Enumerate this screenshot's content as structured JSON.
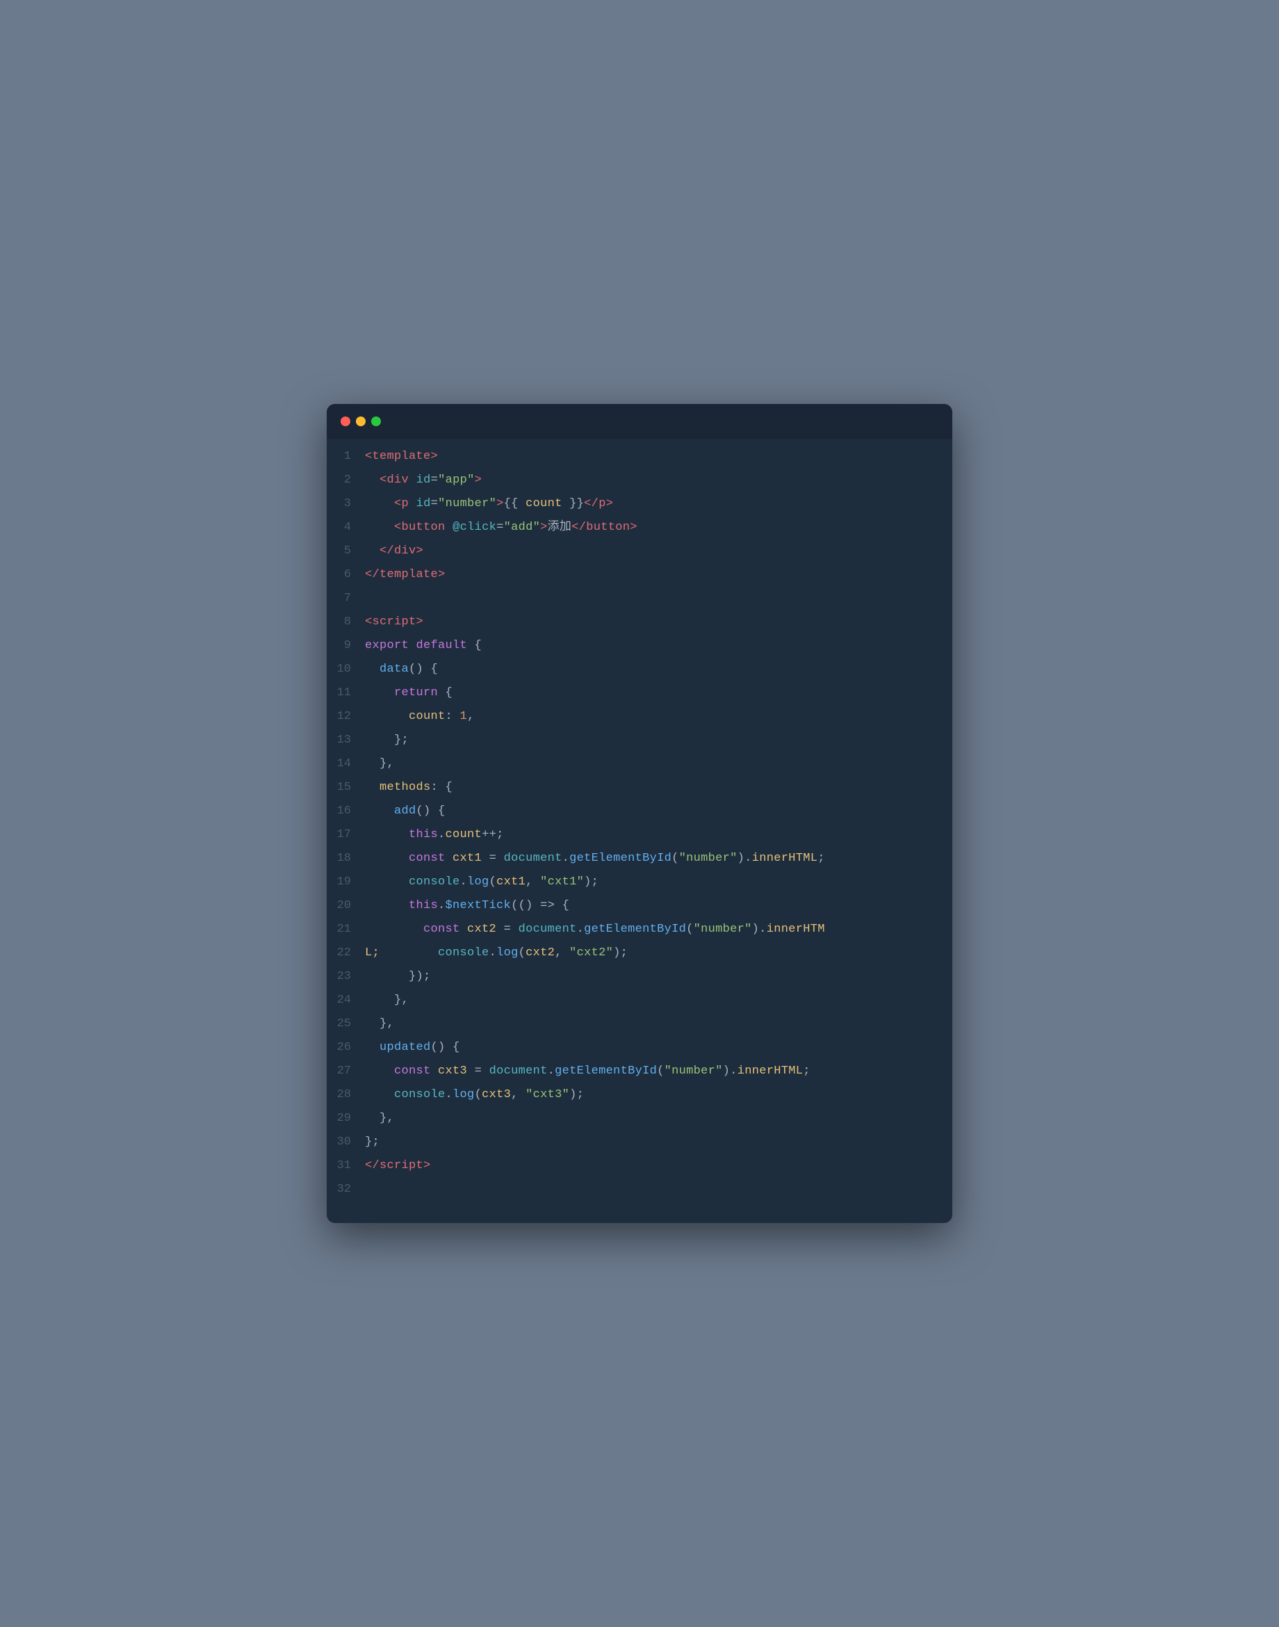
{
  "window": {
    "titlebar": {
      "dot_red": "close",
      "dot_yellow": "minimize",
      "dot_green": "maximize"
    }
  },
  "lines": [
    {
      "num": "1",
      "tokens": [
        {
          "t": "<",
          "c": "c-tag"
        },
        {
          "t": "template",
          "c": "c-tag"
        },
        {
          "t": ">",
          "c": "c-tag"
        }
      ]
    },
    {
      "num": "2",
      "tokens": [
        {
          "t": "  ",
          "c": "c-white"
        },
        {
          "t": "<",
          "c": "c-tag"
        },
        {
          "t": "div",
          "c": "c-tag"
        },
        {
          "t": " ",
          "c": "c-white"
        },
        {
          "t": "id",
          "c": "c-attr"
        },
        {
          "t": "=",
          "c": "c-white"
        },
        {
          "t": "\"app\"",
          "c": "c-string"
        },
        {
          "t": ">",
          "c": "c-tag"
        }
      ]
    },
    {
      "num": "3",
      "tokens": [
        {
          "t": "    ",
          "c": "c-white"
        },
        {
          "t": "<",
          "c": "c-tag"
        },
        {
          "t": "p",
          "c": "c-tag"
        },
        {
          "t": " ",
          "c": "c-white"
        },
        {
          "t": "id",
          "c": "c-attr"
        },
        {
          "t": "=",
          "c": "c-white"
        },
        {
          "t": "\"number\"",
          "c": "c-string"
        },
        {
          "t": ">",
          "c": "c-tag"
        },
        {
          "t": "{{ ",
          "c": "c-interp"
        },
        {
          "t": "count",
          "c": "c-count"
        },
        {
          "t": " }}",
          "c": "c-interp"
        },
        {
          "t": "</",
          "c": "c-tag"
        },
        {
          "t": "p",
          "c": "c-tag"
        },
        {
          "t": ">",
          "c": "c-tag"
        }
      ]
    },
    {
      "num": "4",
      "tokens": [
        {
          "t": "    ",
          "c": "c-white"
        },
        {
          "t": "<",
          "c": "c-tag"
        },
        {
          "t": "button",
          "c": "c-tag"
        },
        {
          "t": " ",
          "c": "c-white"
        },
        {
          "t": "@click",
          "c": "c-attr"
        },
        {
          "t": "=",
          "c": "c-white"
        },
        {
          "t": "\"add\"",
          "c": "c-string"
        },
        {
          "t": ">",
          "c": "c-tag"
        },
        {
          "t": "添加",
          "c": "c-white"
        },
        {
          "t": "</",
          "c": "c-tag"
        },
        {
          "t": "button",
          "c": "c-tag"
        },
        {
          "t": ">",
          "c": "c-tag"
        }
      ]
    },
    {
      "num": "5",
      "tokens": [
        {
          "t": "  ",
          "c": "c-white"
        },
        {
          "t": "</",
          "c": "c-tag"
        },
        {
          "t": "div",
          "c": "c-tag"
        },
        {
          "t": ">",
          "c": "c-tag"
        }
      ]
    },
    {
      "num": "6",
      "tokens": [
        {
          "t": "</",
          "c": "c-tag"
        },
        {
          "t": "template",
          "c": "c-tag"
        },
        {
          "t": ">",
          "c": "c-tag"
        }
      ]
    },
    {
      "num": "7",
      "tokens": []
    },
    {
      "num": "8",
      "tokens": [
        {
          "t": "<",
          "c": "c-tag"
        },
        {
          "t": "script",
          "c": "c-tag"
        },
        {
          "t": ">",
          "c": "c-tag"
        }
      ]
    },
    {
      "num": "9",
      "tokens": [
        {
          "t": "export",
          "c": "c-keyword"
        },
        {
          "t": " ",
          "c": "c-white"
        },
        {
          "t": "default",
          "c": "c-keyword"
        },
        {
          "t": " {",
          "c": "c-white"
        }
      ]
    },
    {
      "num": "10",
      "tokens": [
        {
          "t": "  ",
          "c": "c-white"
        },
        {
          "t": "data",
          "c": "c-func"
        },
        {
          "t": "() {",
          "c": "c-white"
        }
      ]
    },
    {
      "num": "11",
      "tokens": [
        {
          "t": "    ",
          "c": "c-white"
        },
        {
          "t": "return",
          "c": "c-keyword"
        },
        {
          "t": " {",
          "c": "c-white"
        }
      ]
    },
    {
      "num": "12",
      "tokens": [
        {
          "t": "      ",
          "c": "c-white"
        },
        {
          "t": "count",
          "c": "c-var"
        },
        {
          "t": ":",
          "c": "c-white"
        },
        {
          "t": " 1",
          "c": "c-num"
        },
        {
          "t": ",",
          "c": "c-white"
        }
      ]
    },
    {
      "num": "13",
      "tokens": [
        {
          "t": "    ",
          "c": "c-white"
        },
        {
          "t": "};",
          "c": "c-white"
        }
      ]
    },
    {
      "num": "14",
      "tokens": [
        {
          "t": "  ",
          "c": "c-white"
        },
        {
          "t": "},",
          "c": "c-white"
        }
      ]
    },
    {
      "num": "15",
      "tokens": [
        {
          "t": "  ",
          "c": "c-white"
        },
        {
          "t": "methods",
          "c": "c-var"
        },
        {
          "t": ": {",
          "c": "c-white"
        }
      ]
    },
    {
      "num": "16",
      "tokens": [
        {
          "t": "    ",
          "c": "c-white"
        },
        {
          "t": "add",
          "c": "c-func"
        },
        {
          "t": "() {",
          "c": "c-white"
        }
      ]
    },
    {
      "num": "17",
      "tokens": [
        {
          "t": "      ",
          "c": "c-white"
        },
        {
          "t": "this",
          "c": "c-keyword"
        },
        {
          "t": ".",
          "c": "c-white"
        },
        {
          "t": "count",
          "c": "c-var"
        },
        {
          "t": "++;",
          "c": "c-white"
        }
      ]
    },
    {
      "num": "18",
      "tokens": [
        {
          "t": "      ",
          "c": "c-white"
        },
        {
          "t": "const",
          "c": "c-keyword"
        },
        {
          "t": " ",
          "c": "c-white"
        },
        {
          "t": "cxt1",
          "c": "c-var"
        },
        {
          "t": " = ",
          "c": "c-white"
        },
        {
          "t": "document",
          "c": "c-special"
        },
        {
          "t": ".",
          "c": "c-white"
        },
        {
          "t": "getElementById",
          "c": "c-func"
        },
        {
          "t": "(",
          "c": "c-white"
        },
        {
          "t": "\"number\"",
          "c": "c-string"
        },
        {
          "t": ").",
          "c": "c-white"
        },
        {
          "t": "innerHTML",
          "c": "c-var"
        },
        {
          "t": ";",
          "c": "c-white"
        }
      ]
    },
    {
      "num": "19",
      "tokens": [
        {
          "t": "      ",
          "c": "c-white"
        },
        {
          "t": "console",
          "c": "c-special"
        },
        {
          "t": ".",
          "c": "c-white"
        },
        {
          "t": "log",
          "c": "c-func"
        },
        {
          "t": "(",
          "c": "c-white"
        },
        {
          "t": "cxt1",
          "c": "c-var"
        },
        {
          "t": ", ",
          "c": "c-white"
        },
        {
          "t": "\"cxt1\"",
          "c": "c-string"
        },
        {
          "t": ");",
          "c": "c-white"
        }
      ]
    },
    {
      "num": "20",
      "tokens": [
        {
          "t": "      ",
          "c": "c-white"
        },
        {
          "t": "this",
          "c": "c-keyword"
        },
        {
          "t": ".",
          "c": "c-white"
        },
        {
          "t": "$nextTick",
          "c": "c-func"
        },
        {
          "t": "(() => {",
          "c": "c-white"
        }
      ]
    },
    {
      "num": "21",
      "tokens": [
        {
          "t": "        ",
          "c": "c-white"
        },
        {
          "t": "const",
          "c": "c-keyword"
        },
        {
          "t": " ",
          "c": "c-white"
        },
        {
          "t": "cxt2",
          "c": "c-var"
        },
        {
          "t": " = ",
          "c": "c-white"
        },
        {
          "t": "document",
          "c": "c-special"
        },
        {
          "t": ".",
          "c": "c-white"
        },
        {
          "t": "getElementById",
          "c": "c-func"
        },
        {
          "t": "(",
          "c": "c-white"
        },
        {
          "t": "\"number\"",
          "c": "c-string"
        },
        {
          "t": ").",
          "c": "c-white"
        },
        {
          "t": "innerHTM",
          "c": "c-var"
        }
      ]
    },
    {
      "num": "22",
      "tokens": [
        {
          "t": "L;",
          "c": "c-var"
        },
        {
          "t": "        ",
          "c": "c-white"
        },
        {
          "t": "console",
          "c": "c-special"
        },
        {
          "t": ".",
          "c": "c-white"
        },
        {
          "t": "log",
          "c": "c-func"
        },
        {
          "t": "(",
          "c": "c-white"
        },
        {
          "t": "cxt2",
          "c": "c-var"
        },
        {
          "t": ", ",
          "c": "c-white"
        },
        {
          "t": "\"cxt2\"",
          "c": "c-string"
        },
        {
          "t": ");",
          "c": "c-white"
        }
      ]
    },
    {
      "num": "23",
      "tokens": [
        {
          "t": "      ",
          "c": "c-white"
        },
        {
          "t": "});",
          "c": "c-white"
        }
      ]
    },
    {
      "num": "24",
      "tokens": [
        {
          "t": "    ",
          "c": "c-white"
        },
        {
          "t": "},",
          "c": "c-white"
        }
      ]
    },
    {
      "num": "25",
      "tokens": [
        {
          "t": "  ",
          "c": "c-white"
        },
        {
          "t": "},",
          "c": "c-white"
        }
      ]
    },
    {
      "num": "26",
      "tokens": [
        {
          "t": "  ",
          "c": "c-white"
        },
        {
          "t": "updated",
          "c": "c-func"
        },
        {
          "t": "() {",
          "c": "c-white"
        }
      ]
    },
    {
      "num": "27",
      "tokens": [
        {
          "t": "    ",
          "c": "c-white"
        },
        {
          "t": "const",
          "c": "c-keyword"
        },
        {
          "t": " ",
          "c": "c-white"
        },
        {
          "t": "cxt3",
          "c": "c-var"
        },
        {
          "t": " = ",
          "c": "c-white"
        },
        {
          "t": "document",
          "c": "c-special"
        },
        {
          "t": ".",
          "c": "c-white"
        },
        {
          "t": "getElementById",
          "c": "c-func"
        },
        {
          "t": "(",
          "c": "c-white"
        },
        {
          "t": "\"number\"",
          "c": "c-string"
        },
        {
          "t": ").",
          "c": "c-white"
        },
        {
          "t": "innerHTML",
          "c": "c-var"
        },
        {
          "t": ";",
          "c": "c-white"
        }
      ]
    },
    {
      "num": "28",
      "tokens": [
        {
          "t": "    ",
          "c": "c-white"
        },
        {
          "t": "console",
          "c": "c-special"
        },
        {
          "t": ".",
          "c": "c-white"
        },
        {
          "t": "log",
          "c": "c-func"
        },
        {
          "t": "(",
          "c": "c-white"
        },
        {
          "t": "cxt3",
          "c": "c-var"
        },
        {
          "t": ", ",
          "c": "c-white"
        },
        {
          "t": "\"cxt3\"",
          "c": "c-string"
        },
        {
          "t": ");",
          "c": "c-white"
        }
      ]
    },
    {
      "num": "29",
      "tokens": [
        {
          "t": "  ",
          "c": "c-white"
        },
        {
          "t": "},",
          "c": "c-white"
        }
      ]
    },
    {
      "num": "30",
      "tokens": [
        {
          "t": "};",
          "c": "c-white"
        }
      ]
    },
    {
      "num": "31",
      "tokens": [
        {
          "t": "</",
          "c": "c-tag"
        },
        {
          "t": "script",
          "c": "c-tag"
        },
        {
          "t": ">",
          "c": "c-tag"
        }
      ]
    },
    {
      "num": "32",
      "tokens": []
    }
  ]
}
